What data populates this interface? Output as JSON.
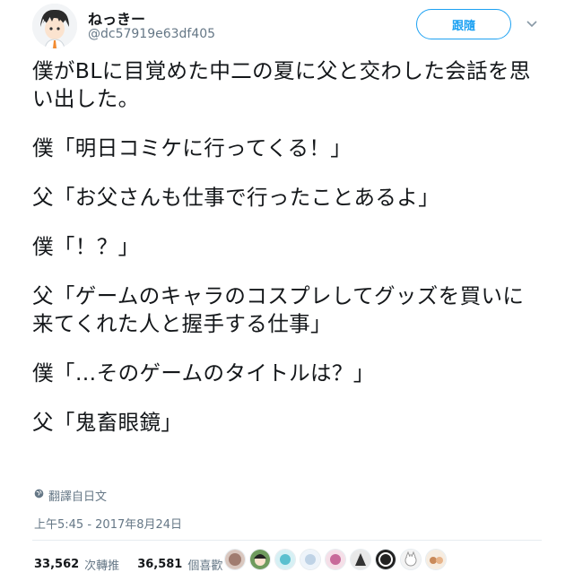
{
  "user": {
    "display_name": "ねっきー",
    "handle": "@dc57919e63df405"
  },
  "follow_button_label": "跟隨",
  "tweet_paragraphs": [
    "僕がBLに目覚めた中二の夏に父と交わした会話を思い出した。",
    "僕「明日コミケに行ってくる！」",
    "父「お父さんも仕事で行ったことあるよ」",
    "僕「！？」",
    "父「ゲームのキャラのコスプレしてグッズを買いに来てくれた人と握手する仕事」",
    "僕「…そのゲームのタイトルは？」",
    "父「鬼畜眼鏡」"
  ],
  "translate_label": "翻譯自日文",
  "timestamp": "上午5:45 - 2017年8月24日",
  "stats": {
    "retweets_count": "33,562",
    "retweets_label": "次轉推",
    "likes_count": "36,581",
    "likes_label": "個喜歡"
  },
  "liker_avatars": [
    "avatar-1",
    "avatar-2",
    "avatar-3",
    "avatar-4",
    "avatar-5",
    "avatar-6",
    "avatar-7",
    "avatar-8",
    "avatar-9"
  ],
  "colors": {
    "accent": "#1da1f2",
    "secondary_text": "#657786",
    "divider": "#e6ecf0"
  }
}
